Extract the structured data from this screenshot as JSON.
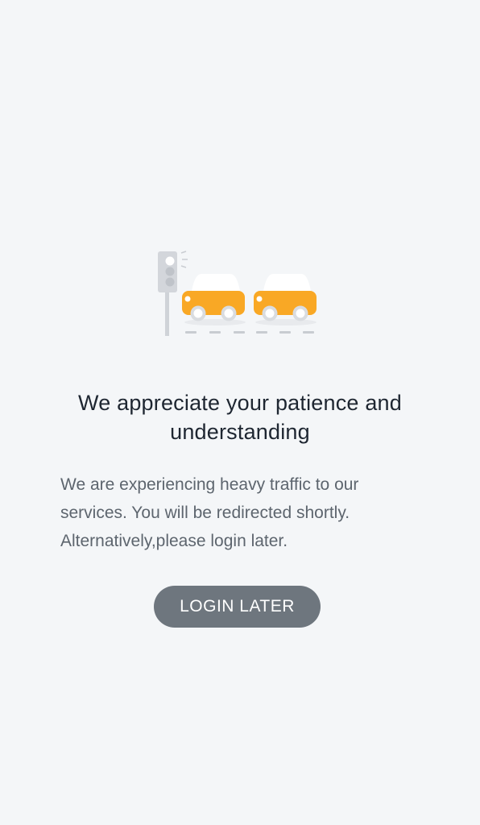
{
  "illustration": {
    "icon": "traffic-jam-illustration",
    "car_color": "#f9a825",
    "traffic_light_color": "#c8ccd2"
  },
  "heading": {
    "line1": "We appreciate your patience and",
    "line2": "understanding"
  },
  "message": {
    "line1": "We are experiencing heavy traffic to our",
    "line2": "services. You will be redirected shortly.",
    "line3": "Alternatively,please login later."
  },
  "actions": {
    "login_later_label": "LOGIN LATER",
    "button_color": "#6e767e"
  }
}
